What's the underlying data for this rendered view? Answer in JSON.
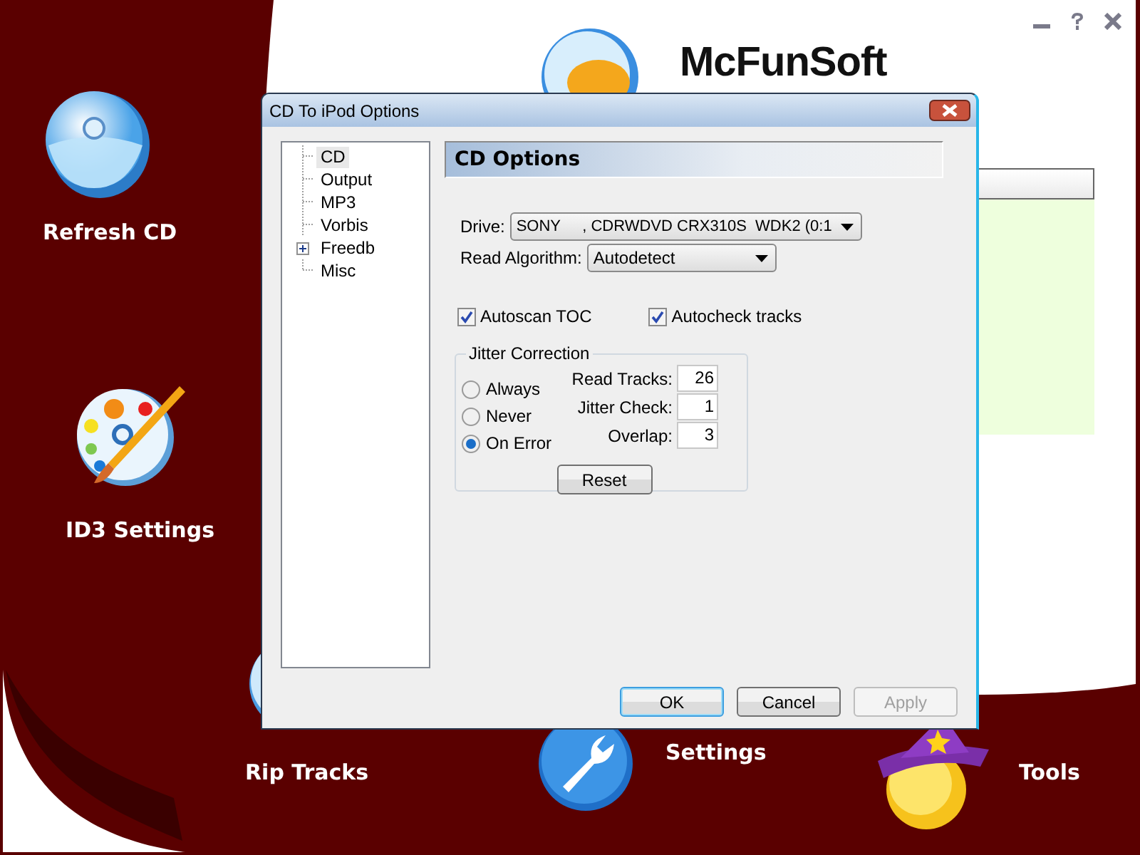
{
  "app": {
    "title": "McFunSoft",
    "actions": [
      {
        "label": "Refresh CD",
        "kind": "disc"
      },
      {
        "label": "ID3 Settings",
        "kind": "palette"
      },
      {
        "label": "Rip Tracks",
        "kind": "rip"
      },
      {
        "label": "Settings",
        "kind": "wrench"
      },
      {
        "label": "Tools",
        "kind": "wizard"
      }
    ]
  },
  "dialog": {
    "title": "CD To iPod Options",
    "tree": [
      {
        "label": "CD",
        "selected": true
      },
      {
        "label": "Output",
        "selected": false
      },
      {
        "label": "MP3",
        "selected": false
      },
      {
        "label": "Vorbis",
        "selected": false
      },
      {
        "label": "Freedb",
        "selected": false,
        "expanded": false
      },
      {
        "label": "Misc",
        "selected": false
      }
    ],
    "section_title": "CD Options",
    "drive": {
      "label": "Drive:",
      "value": "SONY     , CDRWDVD CRX310S  WDK2 (0:1"
    },
    "read_algorithm": {
      "label": "Read Algorithm:",
      "value": "Autodetect"
    },
    "checkboxes": [
      {
        "label": "Autoscan TOC",
        "checked": true
      },
      {
        "label": "Autocheck tracks",
        "checked": true
      }
    ],
    "jitter": {
      "title": "Jitter Correction",
      "options": [
        {
          "label": "Always",
          "selected": false
        },
        {
          "label": "Never",
          "selected": false
        },
        {
          "label": "On Error",
          "selected": true
        }
      ],
      "fields": [
        {
          "label": "Read Tracks:",
          "value": "26"
        },
        {
          "label": "Jitter Check:",
          "value": "1"
        },
        {
          "label": "Overlap:",
          "value": "3"
        }
      ],
      "reset": "Reset"
    },
    "buttons": [
      {
        "label": "OK",
        "default": true,
        "disabled": false
      },
      {
        "label": "Cancel",
        "default": false,
        "disabled": false
      },
      {
        "label": "Apply",
        "default": false,
        "disabled": true
      }
    ]
  }
}
